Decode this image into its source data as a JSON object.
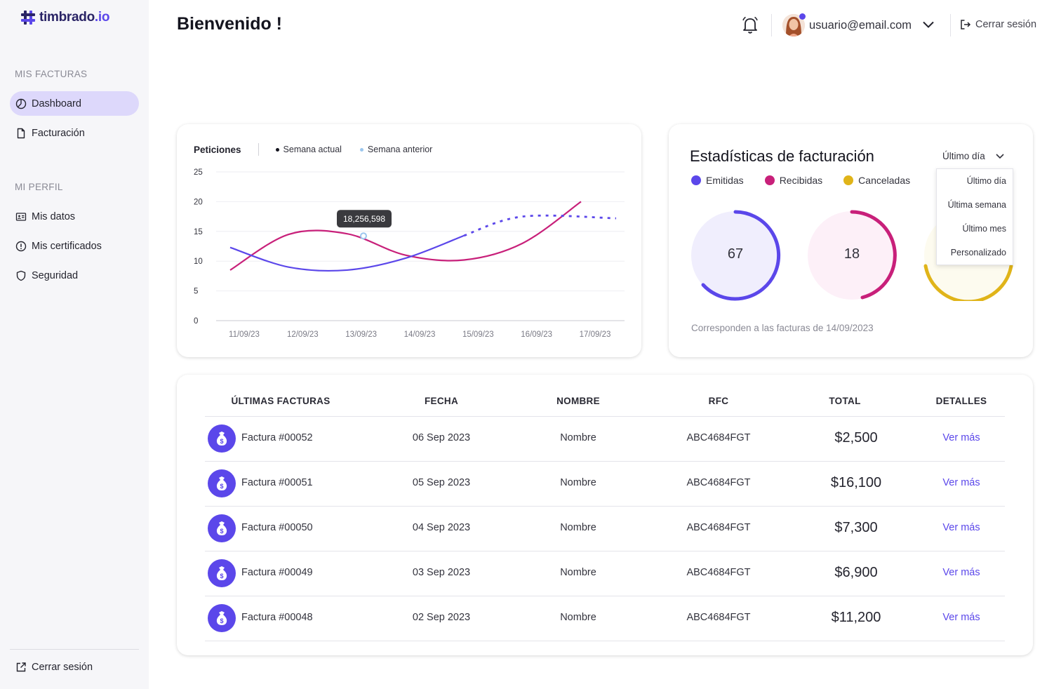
{
  "brand": {
    "name_main": "timbrado",
    "name_suffix": ".io"
  },
  "sidebar": {
    "section_invoices": "MIS FACTURAS",
    "section_profile": "MI PERFIL",
    "items": [
      {
        "label": "Dashboard",
        "icon": "pie-chart-icon",
        "active": true
      },
      {
        "label": "Facturación",
        "icon": "document-icon"
      },
      {
        "label": "Mis datos",
        "icon": "id-card-icon"
      },
      {
        "label": "Mis certificados",
        "icon": "info-circle-icon"
      },
      {
        "label": "Seguridad",
        "icon": "shield-icon"
      }
    ],
    "logout": "Cerrar sesión"
  },
  "header": {
    "title": "Bienvenido !",
    "user_email": "usuario@email.com",
    "logout": "Cerrar sesión"
  },
  "requests_chart": {
    "title": "Peticiones",
    "legend_current": "Semana actual",
    "legend_previous": "Semana anterior",
    "tooltip": "18,256,598"
  },
  "chart_data": {
    "type": "line",
    "title": "Peticiones",
    "x": [
      "11/09/23",
      "12/09/23",
      "13/09/23",
      "14/09/23",
      "15/09/23",
      "16/09/23",
      "17/09/23"
    ],
    "y_ticks": [
      "25",
      "20",
      "15",
      "10",
      "5",
      "0"
    ],
    "ylim": [
      0,
      25
    ],
    "grid": true,
    "series": [
      {
        "name": "Semana actual",
        "color": "#5b47ea",
        "values": [
          12.3,
          9,
          8.5,
          10.5,
          14.3,
          17.5,
          17.2
        ]
      },
      {
        "name": "Semana anterior",
        "color": "#c8207a",
        "values": [
          8.5,
          14.5,
          14.6,
          11,
          10.2,
          13,
          20
        ]
      }
    ]
  },
  "stats": {
    "title": "Estadísticas de facturación",
    "period_selected": "Último día",
    "period_options": [
      "Último día",
      "Última semana",
      "Último mes",
      "Personalizado"
    ],
    "legend": [
      {
        "label": "Emitidas",
        "color": "#5b47ea"
      },
      {
        "label": "Recibidas",
        "color": "#c8207a"
      },
      {
        "label": "Canceladas",
        "color": "#e0b419"
      }
    ],
    "emitidas_value": "67",
    "recibidas_value": "18",
    "note": "Corresponden a las facturas de 14/09/2023"
  },
  "invoices": {
    "headers": {
      "name": "ÚLTIMAS FACTURAS",
      "date": "FECHA",
      "nombre": "NOMBRE",
      "rfc": "RFC",
      "total": "TOTAL",
      "details": "DETALLES"
    },
    "rows": [
      {
        "name": "Factura #00052",
        "date": "06 Sep 2023",
        "nombre": "Nombre",
        "rfc": "ABC4684FGT",
        "total": "$2,500",
        "link": "Ver más"
      },
      {
        "name": "Factura #00051",
        "date": "05 Sep 2023",
        "nombre": "Nombre",
        "rfc": "ABC4684FGT",
        "total": "$16,100",
        "link": "Ver más"
      },
      {
        "name": "Factura #00050",
        "date": "04 Sep 2023",
        "nombre": "Nombre",
        "rfc": "ABC4684FGT",
        "total": "$7,300",
        "link": "Ver más"
      },
      {
        "name": "Factura #00049",
        "date": "03 Sep 2023",
        "nombre": "Nombre",
        "rfc": "ABC4684FGT",
        "total": "$6,900",
        "link": "Ver más"
      },
      {
        "name": "Factura #00048",
        "date": "02 Sep 2023",
        "nombre": "Nombre",
        "rfc": "ABC4684FGT",
        "total": "$11,200",
        "link": "Ver más"
      }
    ]
  }
}
